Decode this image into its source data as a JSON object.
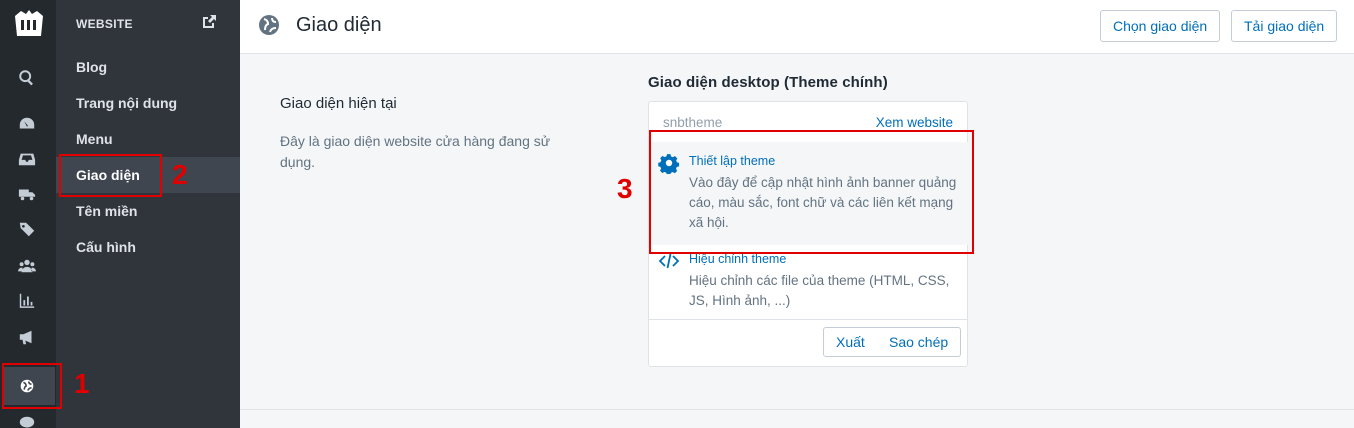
{
  "colors": {
    "rail_bg": "#24292e",
    "sidebar_bg": "#2f353b",
    "accent": "#006fbb",
    "annotation": "#e00000"
  },
  "rail": {
    "icons": [
      "logo-icon",
      "search-icon",
      "dashboard-icon",
      "orders-inbox-icon",
      "shipping-truck-icon",
      "tag-icon",
      "customers-icon",
      "analytics-icon",
      "marketing-megaphone-icon",
      "website-globe-icon",
      "chat-icon"
    ]
  },
  "sidebar": {
    "header": "WEBSITE",
    "items": [
      {
        "label": "Blog"
      },
      {
        "label": "Trang nội dung"
      },
      {
        "label": "Menu"
      },
      {
        "label": "Giao diện"
      },
      {
        "label": "Tên miền"
      },
      {
        "label": "Cấu hình"
      }
    ]
  },
  "topbar": {
    "title": "Giao diện",
    "choose_button": "Chọn giao diện",
    "upload_button": "Tải giao diện"
  },
  "main": {
    "section_title": "Giao diện hiện tại",
    "section_desc": "Đây là giao diện website cửa hàng đang sử dụng.",
    "card_heading": "Giao diện desktop (Theme chính)",
    "card": {
      "theme_name": "snbtheme",
      "view_link": "Xem website",
      "setup_title": "Thiết lập theme",
      "setup_desc": "Vào đây để cập nhật hình ảnh banner quảng cáo, màu sắc, font chữ và các liên kết mạng xã hội.",
      "edit_title": "Hiệu chỉnh theme",
      "edit_desc": "Hiệu chỉnh các file của theme (HTML, CSS, JS, Hình ảnh, ...)",
      "export_button": "Xuất",
      "copy_button": "Sao chép"
    }
  },
  "annotations": {
    "step1": "1",
    "step2": "2",
    "step3": "3"
  }
}
